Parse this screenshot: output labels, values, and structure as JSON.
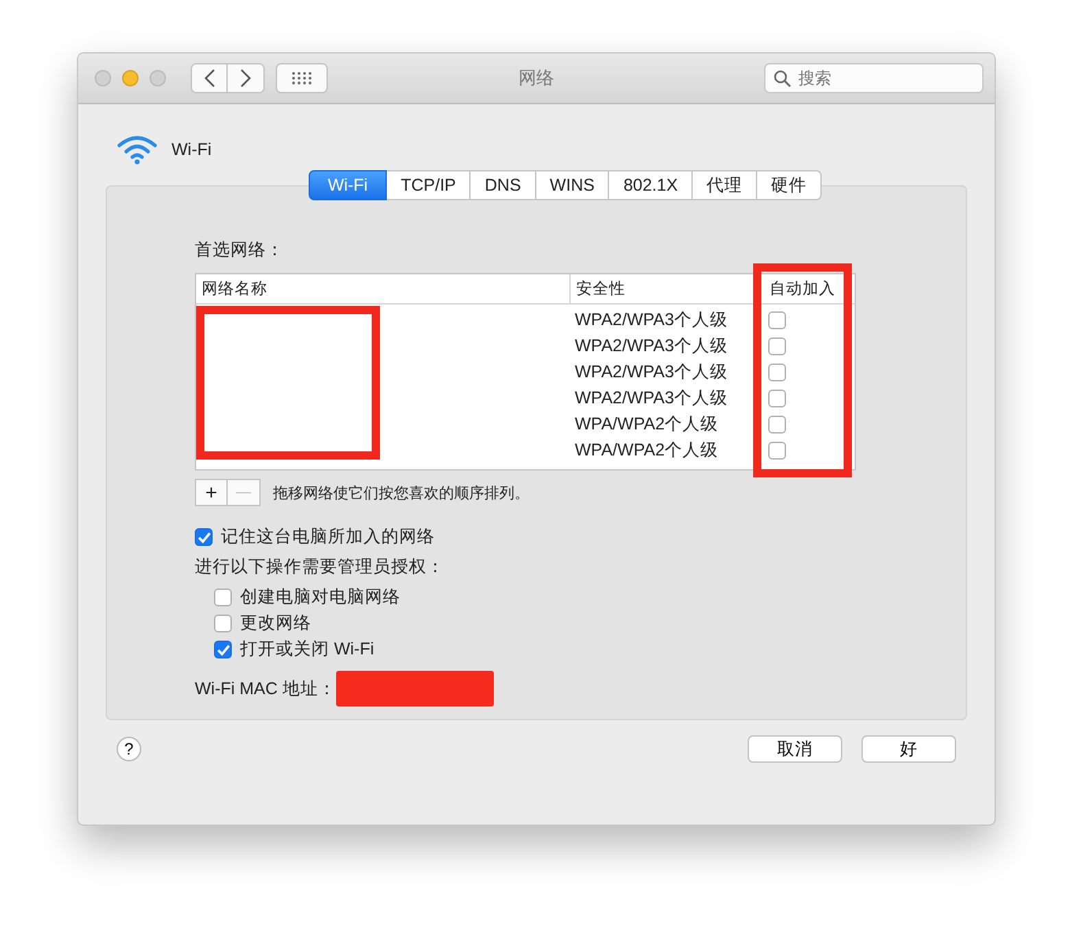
{
  "window": {
    "title": "网络",
    "search": {
      "placeholder": "搜索"
    }
  },
  "header": {
    "label": "Wi-Fi"
  },
  "tabs": [
    {
      "label": "Wi-Fi",
      "selected": true
    },
    {
      "label": "TCP/IP",
      "selected": false
    },
    {
      "label": "DNS",
      "selected": false
    },
    {
      "label": "WINS",
      "selected": false
    },
    {
      "label": "802.1X",
      "selected": false
    },
    {
      "label": "代理",
      "selected": false
    },
    {
      "label": "硬件",
      "selected": false
    }
  ],
  "preferred_networks": {
    "label": "首选网络：",
    "columns": [
      "网络名称",
      "安全性",
      "自动加入"
    ],
    "rows": [
      {
        "security": "WPA2/WPA3个人级",
        "auto_join": false
      },
      {
        "security": "WPA2/WPA3个人级",
        "auto_join": false
      },
      {
        "security": "WPA2/WPA3个人级",
        "auto_join": false
      },
      {
        "security": "WPA2/WPA3个人级",
        "auto_join": false
      },
      {
        "security": "WPA/WPA2个人级",
        "auto_join": false
      },
      {
        "security": "WPA/WPA2个人级",
        "auto_join": false
      }
    ],
    "add_button": {
      "label": "+",
      "disabled": false
    },
    "remove_button": {
      "label": "—",
      "disabled": true
    },
    "hint": "拖移网络使它们按您喜欢的顺序排列。"
  },
  "remember": {
    "label": "记住这台电脑所加入的网络",
    "checked": true
  },
  "admin": {
    "label": "进行以下操作需要管理员授权：",
    "options": [
      {
        "label": "创建电脑对电脑网络",
        "checked": false
      },
      {
        "label": "更改网络",
        "checked": false
      },
      {
        "label": "打开或关闭 Wi-Fi",
        "checked": true
      }
    ]
  },
  "mac_label": "Wi-Fi MAC 地址：",
  "help": "?",
  "buttons": [
    "取消",
    "好"
  ]
}
